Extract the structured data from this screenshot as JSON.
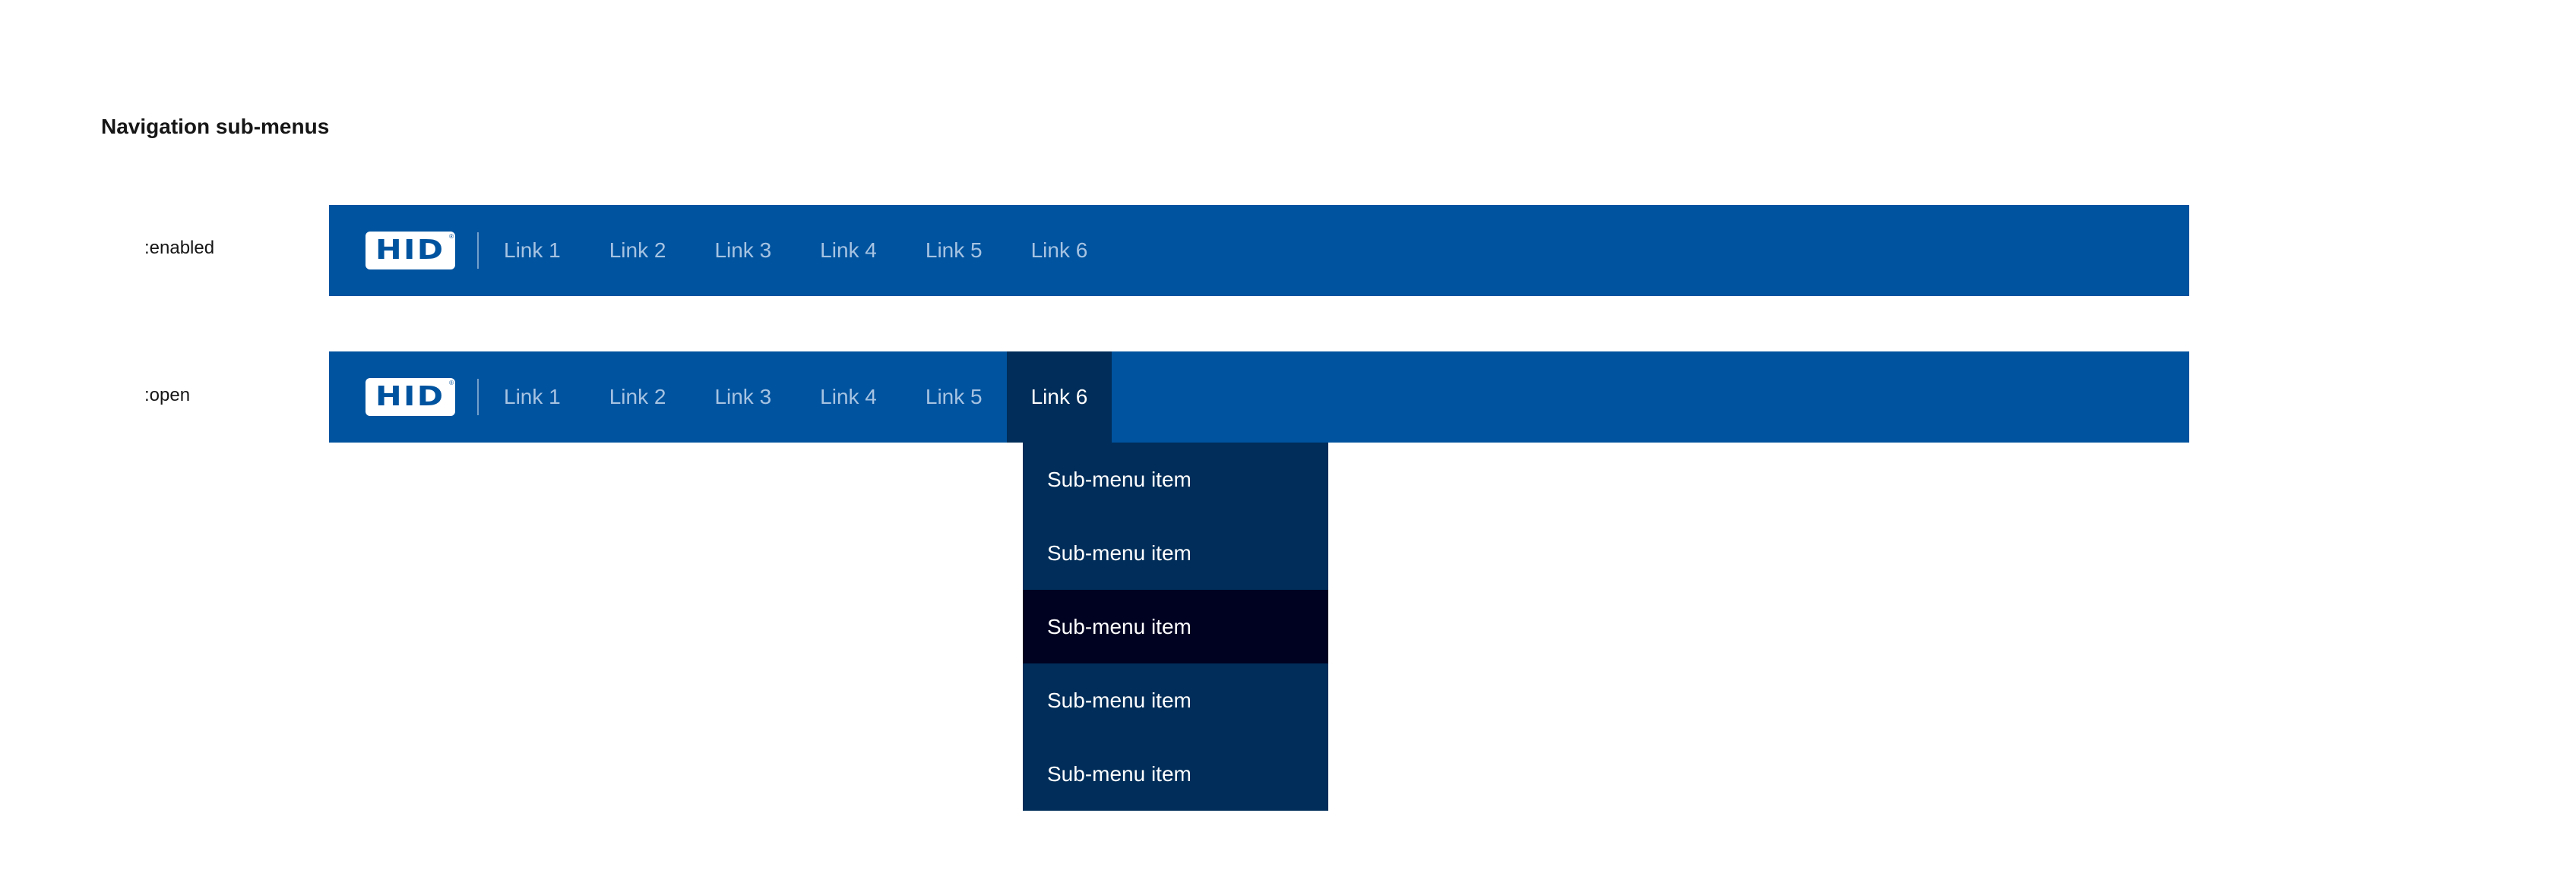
{
  "page": {
    "title": "Navigation sub-menus"
  },
  "states": {
    "enabled": ":enabled",
    "open": ":open"
  },
  "logo": {
    "text": "HID",
    "mark": "®"
  },
  "nav": {
    "links": [
      "Link 1",
      "Link 2",
      "Link 3",
      "Link 4",
      "Link 5",
      "Link 6"
    ],
    "open_link_index": 5
  },
  "submenu": {
    "items": [
      "Sub-menu item",
      "Sub-menu item",
      "Sub-menu item",
      "Sub-menu item",
      "Sub-menu item"
    ],
    "highlighted_index": 2
  },
  "colors": {
    "navbar_bg": "#00539f",
    "link_text": "#a6c3e2",
    "open_link_bg": "#002d59",
    "submenu_bg": "#002d59",
    "submenu_highlight_bg": "#000222",
    "logo_bg": "#ffffff",
    "logo_text": "#00539f"
  }
}
